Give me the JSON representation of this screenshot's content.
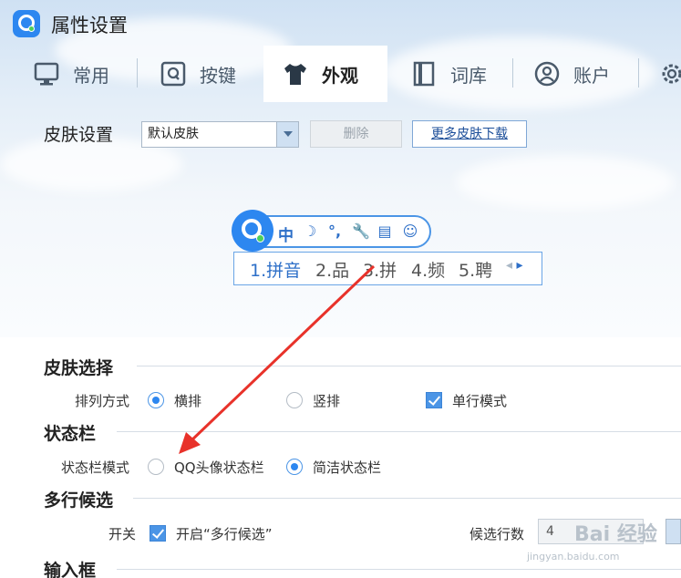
{
  "app": {
    "title": "属性设置"
  },
  "tabs": [
    {
      "label": "常用",
      "icon": "monitor-icon"
    },
    {
      "label": "按键",
      "icon": "key-icon"
    },
    {
      "label": "外观",
      "icon": "shirt-icon",
      "active": true
    },
    {
      "label": "词库",
      "icon": "book-icon"
    },
    {
      "label": "账户",
      "icon": "user-icon"
    },
    {
      "label": "",
      "icon": "gear-icon"
    }
  ],
  "skin": {
    "label": "皮肤设置",
    "selected": "默认皮肤",
    "delete_label": "删除",
    "more_label": "更多皮肤下载"
  },
  "preview": {
    "mode": "中",
    "candidates": [
      "1.拼音",
      "2.品",
      "3.拼",
      "4.频",
      "5.聘"
    ]
  },
  "sections": {
    "skin_select": {
      "title": "皮肤选择",
      "layout_label": "排列方式",
      "horizontal": "横排",
      "vertical": "竖排",
      "single_line": "单行模式"
    },
    "status_bar": {
      "title": "状态栏",
      "mode_label": "状态栏模式",
      "qq_avatar": "QQ头像状态栏",
      "simple": "简洁状态栏"
    },
    "multi_line": {
      "title": "多行候选",
      "switch_label": "开关",
      "enable_label": "开启“多行候选”",
      "rows_label": "候选行数",
      "rows_value": "4"
    },
    "input_box": {
      "title": "输入框"
    }
  },
  "watermark": {
    "text": "Bai 经验",
    "url": "jingyan.baidu.com"
  },
  "colors": {
    "accent": "#2d87f0",
    "arrow": "#e8322a",
    "active_check": "#4b95e6"
  }
}
